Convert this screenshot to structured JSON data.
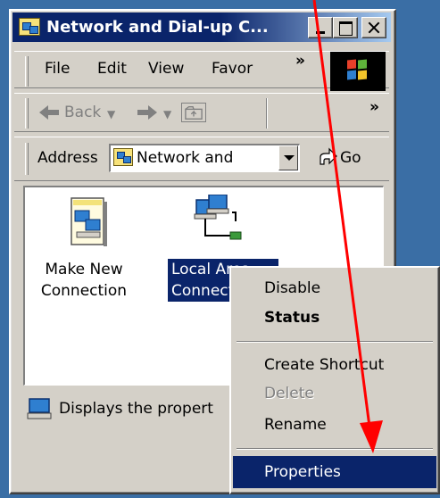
{
  "window": {
    "title": "Network and Dial-up C..."
  },
  "menubar": {
    "items": [
      "File",
      "Edit",
      "View",
      "Favor"
    ],
    "more": "»"
  },
  "toolbar": {
    "back_label": "Back",
    "more": "»"
  },
  "addressbar": {
    "label": "Address",
    "value": "Network and",
    "go_label": "Go"
  },
  "content": {
    "items": [
      {
        "label_line1": "Make New",
        "label_line2": "Connection",
        "selected": false
      },
      {
        "label_line1": "Local Area",
        "label_line2": "Connection",
        "selected": true
      }
    ]
  },
  "statusbar": {
    "text": "Displays the propert"
  },
  "context_menu": {
    "items": [
      {
        "label": "Disable",
        "state": "normal"
      },
      {
        "label": "Status",
        "state": "default"
      },
      {
        "label": "Create Shortcut",
        "state": "normal"
      },
      {
        "label": "Delete",
        "state": "disabled"
      },
      {
        "label": "Rename",
        "state": "normal"
      },
      {
        "label": "Properties",
        "state": "highlighted"
      }
    ]
  },
  "colors": {
    "desktop": "#3a6ea5",
    "titlebar": "#0a246a",
    "face": "#d4d0c8",
    "annotation_arrow": "#ff0000"
  },
  "icons": {
    "window": "network-folder-icon",
    "make_new_connection": "make-new-connection-icon",
    "local_area_connection": "lan-connection-icon",
    "status": "computer-icon",
    "windows_logo": "windows-flag-icon"
  }
}
